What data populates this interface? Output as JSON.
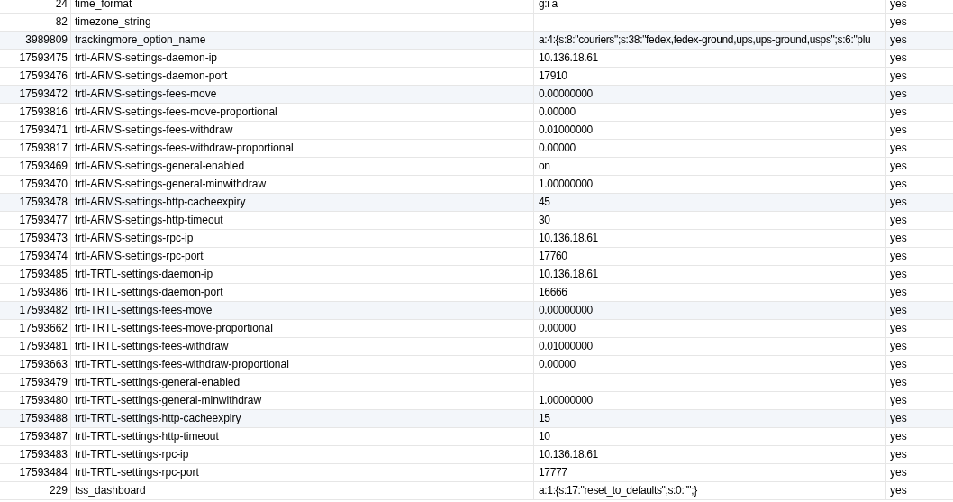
{
  "table": {
    "rows": [
      {
        "id": "24",
        "name": "time_format",
        "value": "g:i a",
        "autoload": "yes",
        "highlighted": false
      },
      {
        "id": "82",
        "name": "timezone_string",
        "value": "",
        "autoload": "yes",
        "highlighted": false
      },
      {
        "id": "3989809",
        "name": "trackingmore_option_name",
        "value": "a:4:{s:8:\"couriers\";s:38:\"fedex,fedex-ground,ups,ups-ground,usps\";s:6:\"plu",
        "autoload": "yes",
        "highlighted": true
      },
      {
        "id": "17593475",
        "name": "trtl-ARMS-settings-daemon-ip",
        "value": "10.136.18.61",
        "autoload": "yes",
        "highlighted": false
      },
      {
        "id": "17593476",
        "name": "trtl-ARMS-settings-daemon-port",
        "value": "17910",
        "autoload": "yes",
        "highlighted": false
      },
      {
        "id": "17593472",
        "name": "trtl-ARMS-settings-fees-move",
        "value": "0.00000000",
        "autoload": "yes",
        "highlighted": true
      },
      {
        "id": "17593816",
        "name": "trtl-ARMS-settings-fees-move-proportional",
        "value": "0.00000",
        "autoload": "yes",
        "highlighted": false
      },
      {
        "id": "17593471",
        "name": "trtl-ARMS-settings-fees-withdraw",
        "value": "0.01000000",
        "autoload": "yes",
        "highlighted": false
      },
      {
        "id": "17593817",
        "name": "trtl-ARMS-settings-fees-withdraw-proportional",
        "value": "0.00000",
        "autoload": "yes",
        "highlighted": false
      },
      {
        "id": "17593469",
        "name": "trtl-ARMS-settings-general-enabled",
        "value": "on",
        "autoload": "yes",
        "highlighted": false
      },
      {
        "id": "17593470",
        "name": "trtl-ARMS-settings-general-minwithdraw",
        "value": "1.00000000",
        "autoload": "yes",
        "highlighted": false
      },
      {
        "id": "17593478",
        "name": "trtl-ARMS-settings-http-cacheexpiry",
        "value": "45",
        "autoload": "yes",
        "highlighted": true
      },
      {
        "id": "17593477",
        "name": "trtl-ARMS-settings-http-timeout",
        "value": "30",
        "autoload": "yes",
        "highlighted": false
      },
      {
        "id": "17593473",
        "name": "trtl-ARMS-settings-rpc-ip",
        "value": "10.136.18.61",
        "autoload": "yes",
        "highlighted": false
      },
      {
        "id": "17593474",
        "name": "trtl-ARMS-settings-rpc-port",
        "value": "17760",
        "autoload": "yes",
        "highlighted": false
      },
      {
        "id": "17593485",
        "name": "trtl-TRTL-settings-daemon-ip",
        "value": "10.136.18.61",
        "autoload": "yes",
        "highlighted": false
      },
      {
        "id": "17593486",
        "name": "trtl-TRTL-settings-daemon-port",
        "value": "16666",
        "autoload": "yes",
        "highlighted": false
      },
      {
        "id": "17593482",
        "name": "trtl-TRTL-settings-fees-move",
        "value": "0.00000000",
        "autoload": "yes",
        "highlighted": true
      },
      {
        "id": "17593662",
        "name": "trtl-TRTL-settings-fees-move-proportional",
        "value": "0.00000",
        "autoload": "yes",
        "highlighted": false
      },
      {
        "id": "17593481",
        "name": "trtl-TRTL-settings-fees-withdraw",
        "value": "0.01000000",
        "autoload": "yes",
        "highlighted": false
      },
      {
        "id": "17593663",
        "name": "trtl-TRTL-settings-fees-withdraw-proportional",
        "value": "0.00000",
        "autoload": "yes",
        "highlighted": false
      },
      {
        "id": "17593479",
        "name": "trtl-TRTL-settings-general-enabled",
        "value": "",
        "autoload": "yes",
        "highlighted": false
      },
      {
        "id": "17593480",
        "name": "trtl-TRTL-settings-general-minwithdraw",
        "value": "1.00000000",
        "autoload": "yes",
        "highlighted": false
      },
      {
        "id": "17593488",
        "name": "trtl-TRTL-settings-http-cacheexpiry",
        "value": "15",
        "autoload": "yes",
        "highlighted": true
      },
      {
        "id": "17593487",
        "name": "trtl-TRTL-settings-http-timeout",
        "value": "10",
        "autoload": "yes",
        "highlighted": false
      },
      {
        "id": "17593483",
        "name": "trtl-TRTL-settings-rpc-ip",
        "value": "10.136.18.61",
        "autoload": "yes",
        "highlighted": false
      },
      {
        "id": "17593484",
        "name": "trtl-TRTL-settings-rpc-port",
        "value": "17777",
        "autoload": "yes",
        "highlighted": false
      },
      {
        "id": "229",
        "name": "tss_dashboard",
        "value": "a:1:{s:17:\"reset_to_defaults\";s:0:\"\";}",
        "autoload": "yes",
        "highlighted": false
      }
    ]
  }
}
